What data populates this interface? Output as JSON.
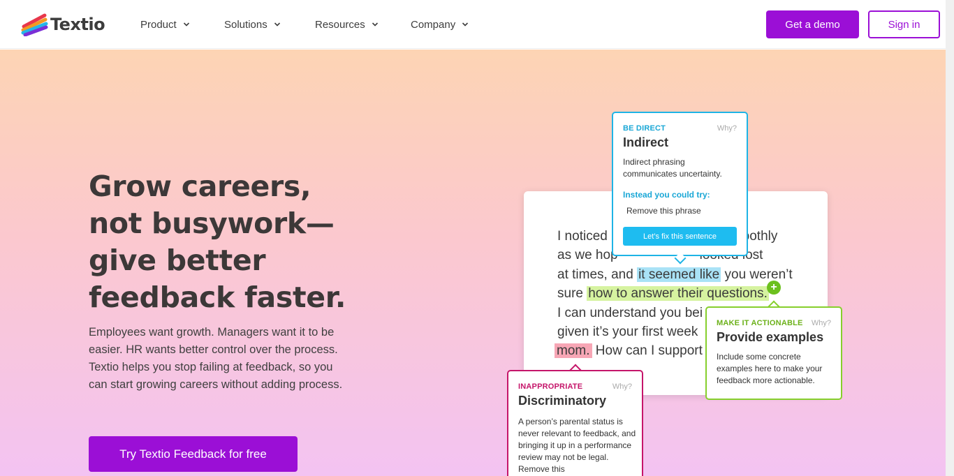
{
  "header": {
    "logo_text": "Textio",
    "nav": [
      {
        "label": "Product"
      },
      {
        "label": "Solutions"
      },
      {
        "label": "Resources"
      },
      {
        "label": "Company"
      }
    ],
    "demo_label": "Get a demo",
    "signin_label": "Sign in"
  },
  "hero": {
    "headline_lines": [
      "Grow careers,",
      "not busywork—",
      "give better",
      "feedback faster."
    ],
    "subcopy": "Employees want growth. Managers want it to be easier. HR wants better control over the process. Textio helps you stop failing at feedback, so you can start growing careers without adding process.",
    "cta_label": "Try Textio Feedback for free"
  },
  "doc": {
    "line1": "I noticed",
    "line1_end": "moothly",
    "line2_start": "as we hop",
    "line2_end": "looked lost",
    "line3_start": "at times, and",
    "line3_hl": "it seemed like",
    "line3_end": "you weren’t",
    "line4_start": "sure",
    "line4_hl": "how to answer their questions.",
    "line5": "I can understand you bei",
    "line6": "given it’s your first week",
    "line7_hl": "mom.",
    "line7_end": "How can I support"
  },
  "callouts": {
    "direct": {
      "tag": "BE DIRECT",
      "why": "Why?",
      "title": "Indirect",
      "body": "Indirect phrasing communicates uncertainty.",
      "try_label": "Instead you could try:",
      "suggestion": "Remove this phrase",
      "button": "Let’s fix this sentence"
    },
    "actionable": {
      "tag": "MAKE IT ACTIONABLE",
      "why": "Why?",
      "title": "Provide examples",
      "body": "Include some concrete examples here to make your feedback more actionable."
    },
    "inappropriate": {
      "tag": "INAPPROPRIATE",
      "why": "Why?",
      "title": "Discriminatory",
      "body": "A person’s parental status is never relevant to feedback, and bringing it up in a performance review may not be legal. Remove this"
    }
  },
  "colors": {
    "accent": "#9b0fd6",
    "blue": "#1eb4e6",
    "green": "#86cf2c",
    "pink": "#c5156a"
  }
}
